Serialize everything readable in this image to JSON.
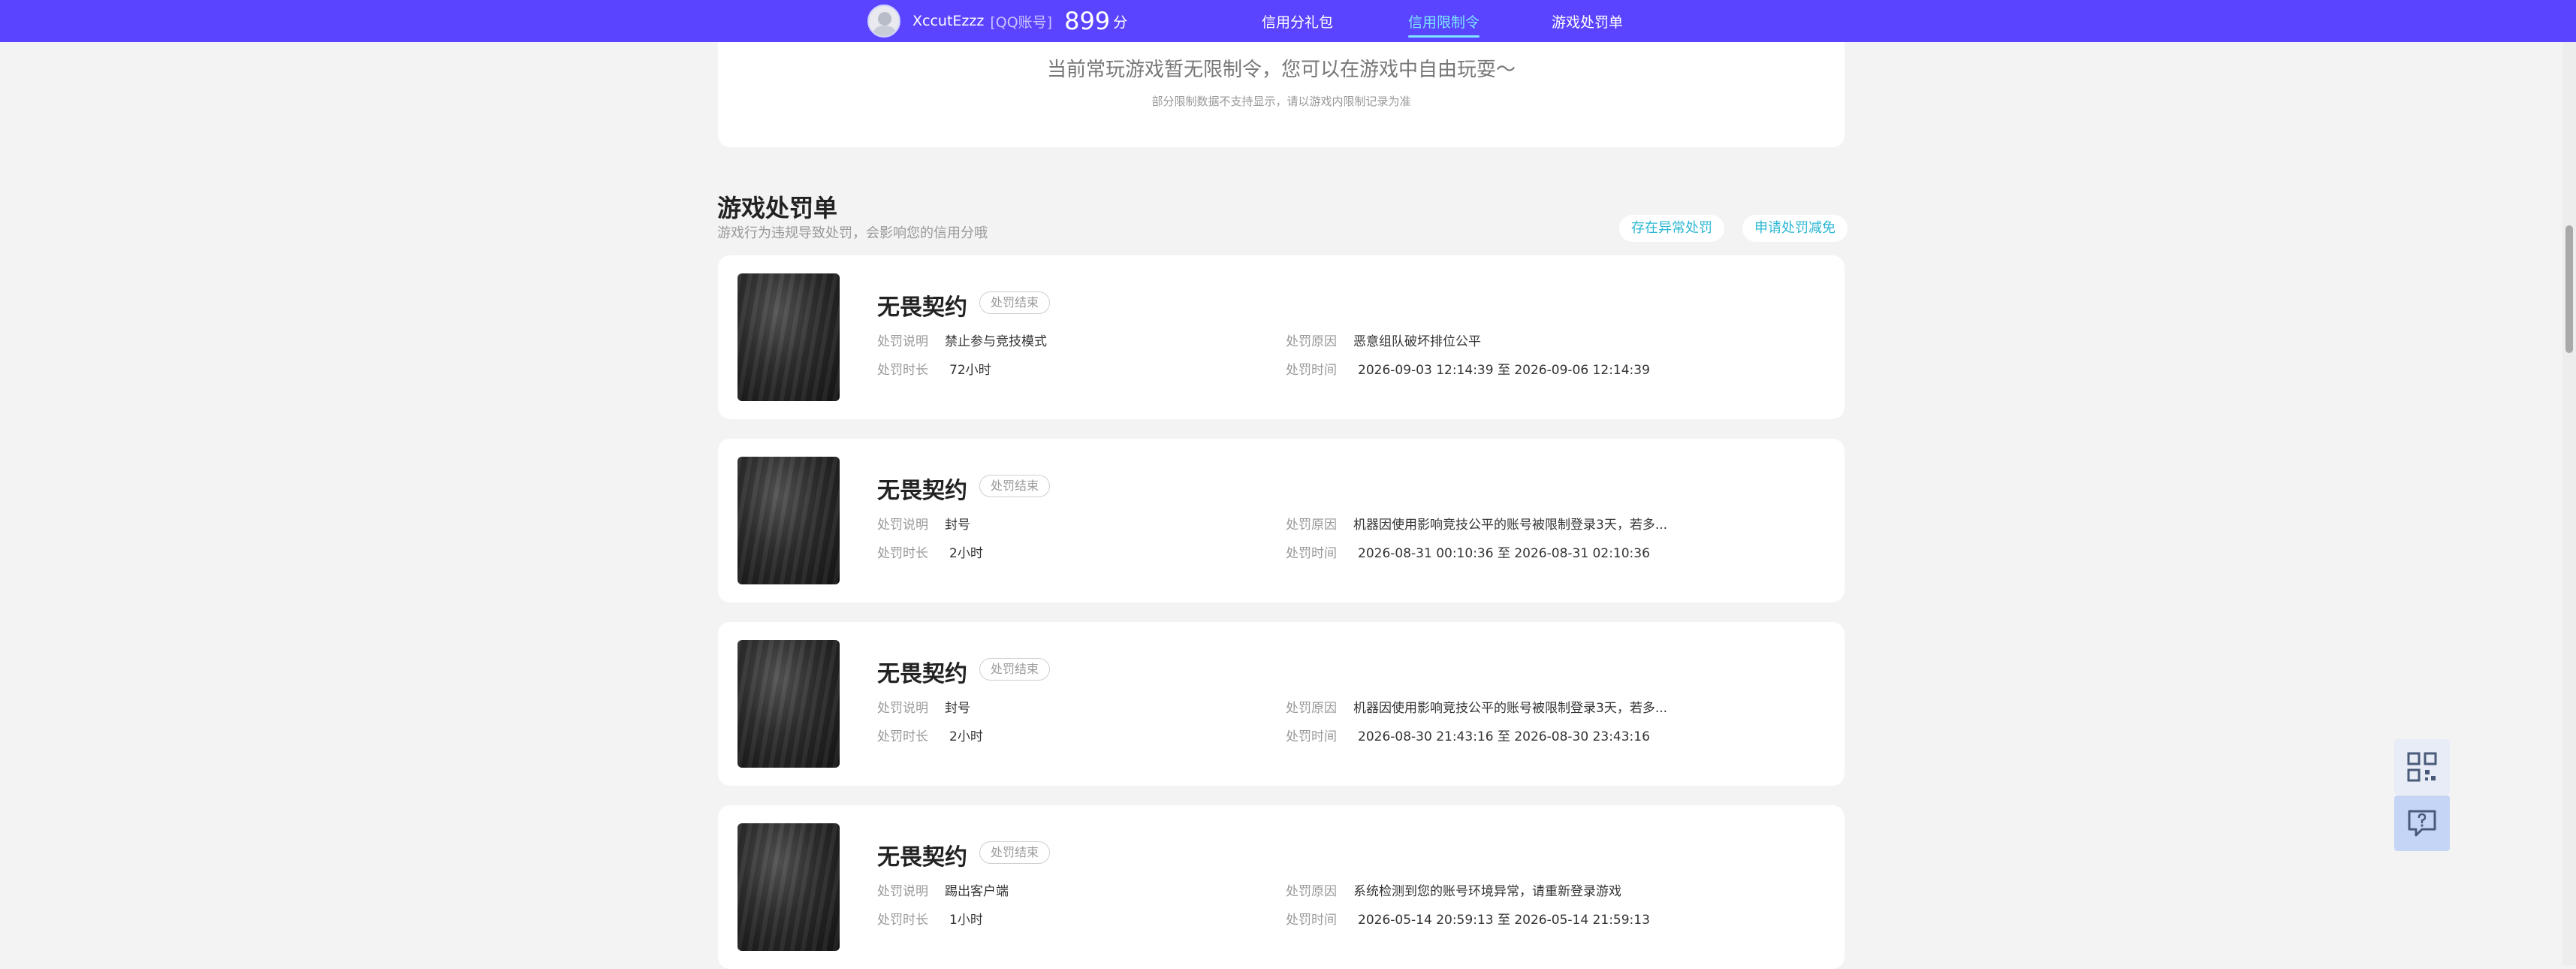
{
  "topbar": {
    "username": "XccutEzzz",
    "account_type": "[QQ账号]",
    "score": "899",
    "score_unit": "分",
    "nav": [
      {
        "label": "信用分礼包"
      },
      {
        "label": "信用限制令"
      },
      {
        "label": "游戏处罚单"
      }
    ]
  },
  "notice": {
    "main": "当前常玩游戏暂无限制令，您可以在游戏中自由玩耍～",
    "sub": "部分限制数据不支持显示，请以游戏内限制记录为准"
  },
  "section": {
    "title": "游戏处罚单",
    "subtitle": "游戏行为违规导致处罚，会影响您的信用分哦",
    "btn_abnormal": "存在异常处罚",
    "btn_apply": "申请处罚减免"
  },
  "labels": {
    "desc": "处罚说明",
    "length": "处罚时长",
    "reason": "处罚原因",
    "time": "处罚时间"
  },
  "penalties": [
    {
      "game": "无畏契约",
      "status": "处罚结束",
      "desc": "禁止参与竞技模式",
      "length": "72小时",
      "reason": "恶意组队破坏排位公平",
      "time": "2026-09-03 12:14:39 至 2026-09-06 12:14:39"
    },
    {
      "game": "无畏契约",
      "status": "处罚结束",
      "desc": "封号",
      "length": "2小时",
      "reason": "机器因使用影响竞技公平的账号被限制登录3天，若多...",
      "time": "2026-08-31 00:10:36 至 2026-08-31 02:10:36"
    },
    {
      "game": "无畏契约",
      "status": "处罚结束",
      "desc": "封号",
      "length": "2小时",
      "reason": "机器因使用影响竞技公平的账号被限制登录3天，若多...",
      "time": "2026-08-30 21:43:16 至 2026-08-30 23:43:16"
    },
    {
      "game": "无畏契约",
      "status": "处罚结束",
      "desc": "踢出客户端",
      "length": "1小时",
      "reason": "系统检测到您的账号环境异常，请重新登录游戏",
      "time": "2026-05-14 20:59:13 至 2026-05-14 21:59:13"
    }
  ],
  "icons": {
    "qr": "qr-code-icon",
    "help": "help-chat-icon"
  },
  "colors": {
    "topbar": "#5a44ff",
    "active_nav": "#7de4ff",
    "accent": "#2bb7d3",
    "page_bg": "#f3f3f3"
  }
}
